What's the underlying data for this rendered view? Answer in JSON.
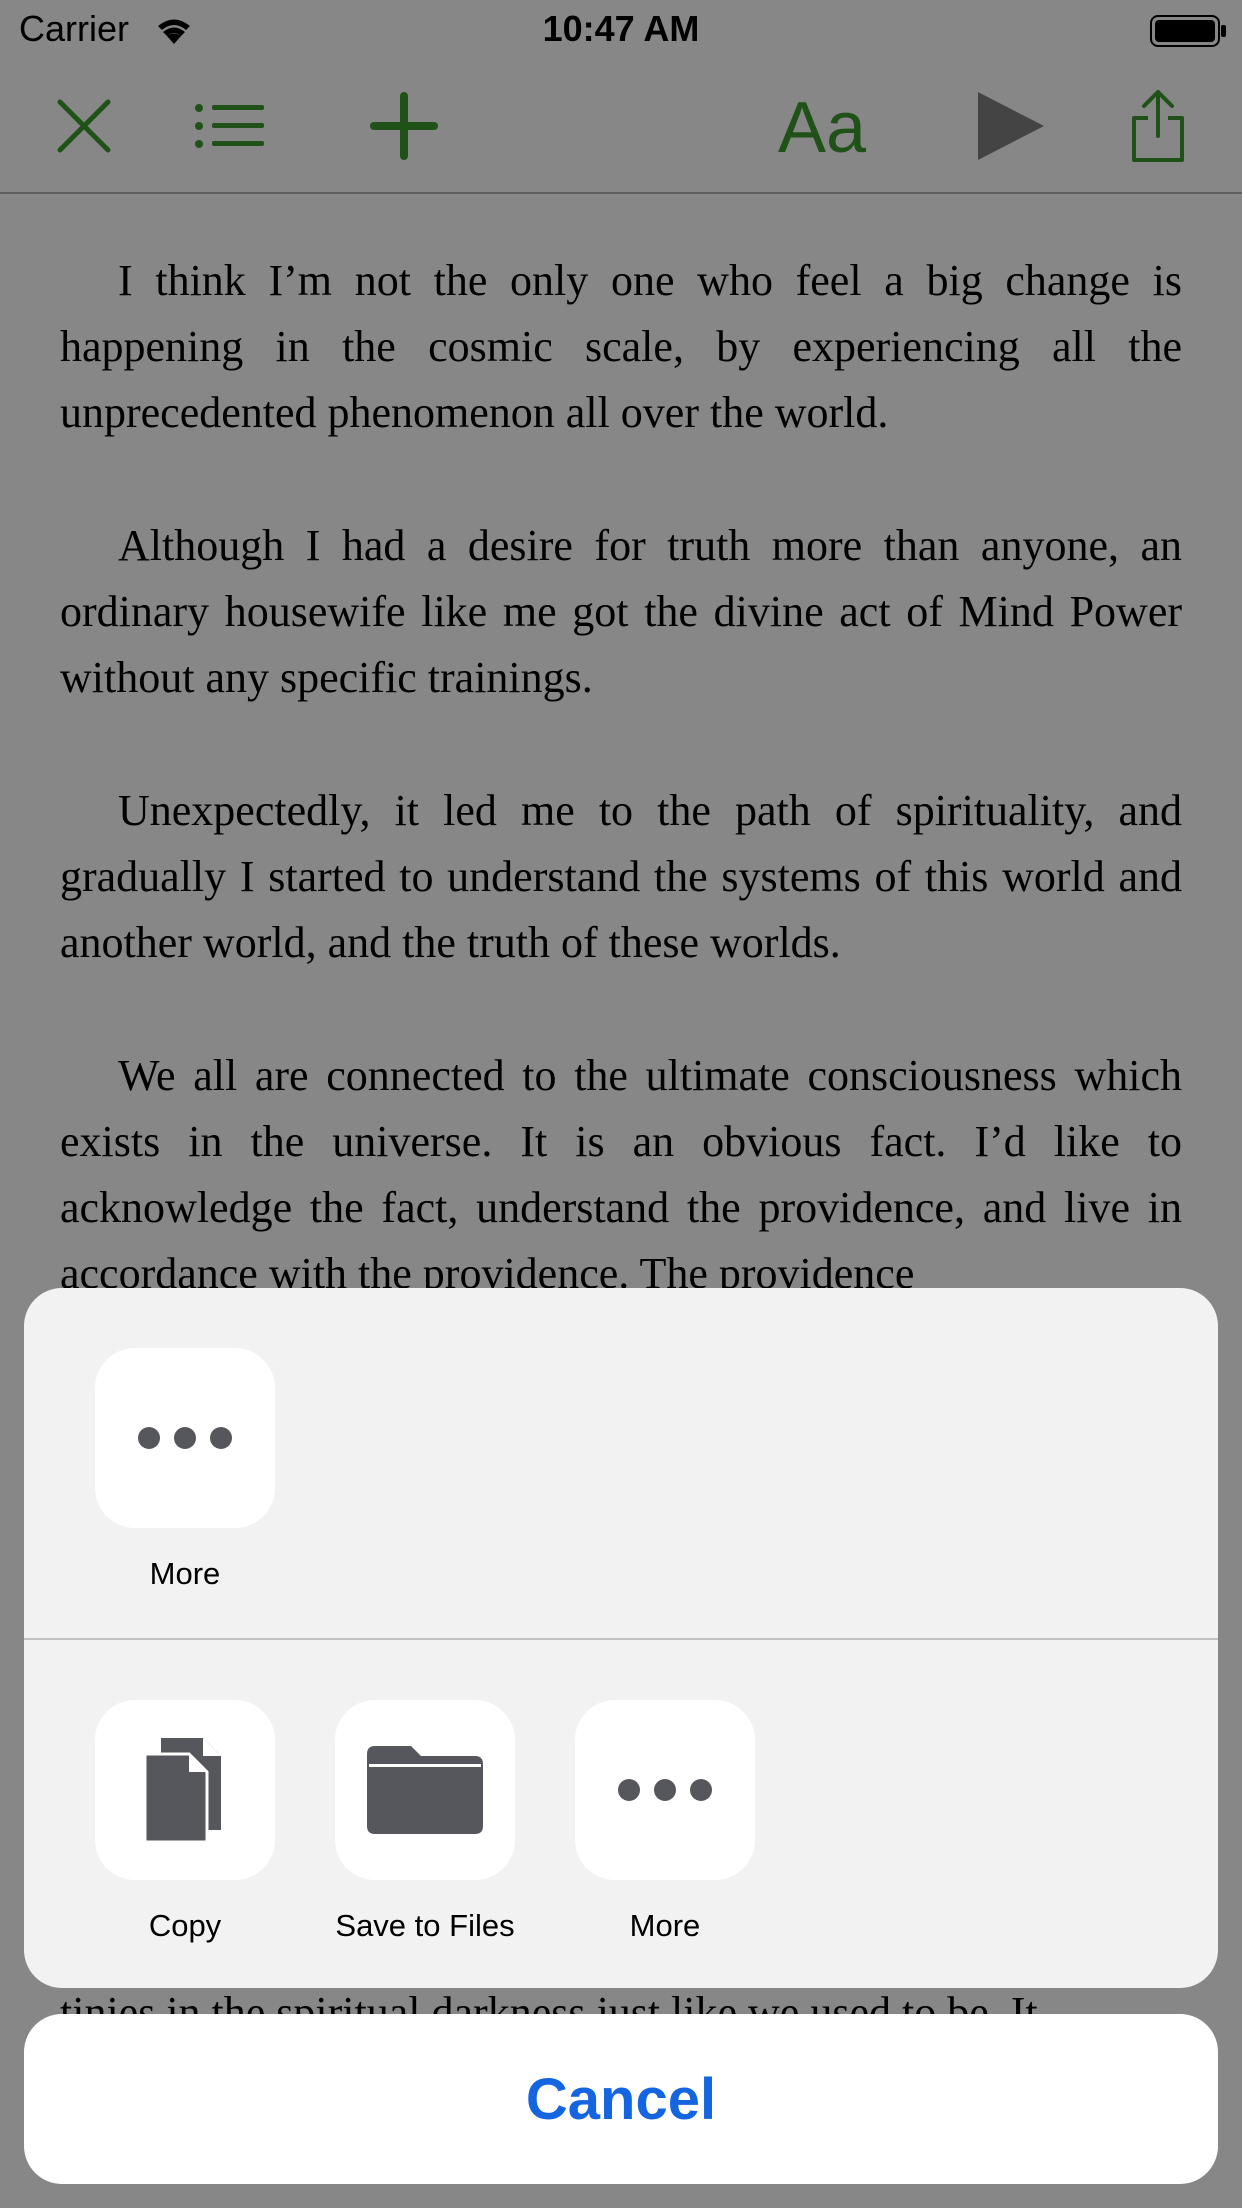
{
  "status_bar": {
    "carrier": "Carrier",
    "time": "10:47 AM"
  },
  "toolbar": {
    "accent_color": "#3c9a2e",
    "close_icon": "close-icon",
    "toc_icon": "list-icon",
    "add_icon": "plus-icon",
    "font_label": "Aa",
    "play_icon": "play-icon",
    "share_icon": "share-icon"
  },
  "content": {
    "paragraphs": [
      "I think I’m not the only one who feel a big change is happening in the cosmic scale, by experiencing all the unprecedented phenomenon all over the world.",
      "Although I had a desire for truth more than anyone, an ordinary housewife like me got the divine act of Mind Power without any specific trainings.",
      "Unexpectedly, it led me to the path of spirituality, and gradually I started to understand the systems of this world and another world, and the truth of these worlds.",
      "We all are connected to the ultimate consciousness which exists in the universe. It is an obvious fact. I’d like to acknowledge the fact, understand the providence, and live in accordance with the providence. The providence"
    ],
    "trailing_line": "tinies in the spiritual darkness just like we used to be. It"
  },
  "share_sheet": {
    "row1": [
      {
        "label": "More",
        "icon": "more-icon"
      }
    ],
    "row2": [
      {
        "label": "Copy",
        "icon": "copy-icon"
      },
      {
        "label": "Save to Files",
        "icon": "folder-icon"
      },
      {
        "label": "More",
        "icon": "more-icon"
      }
    ],
    "cancel_label": "Cancel",
    "cancel_color": "#1565e0"
  }
}
